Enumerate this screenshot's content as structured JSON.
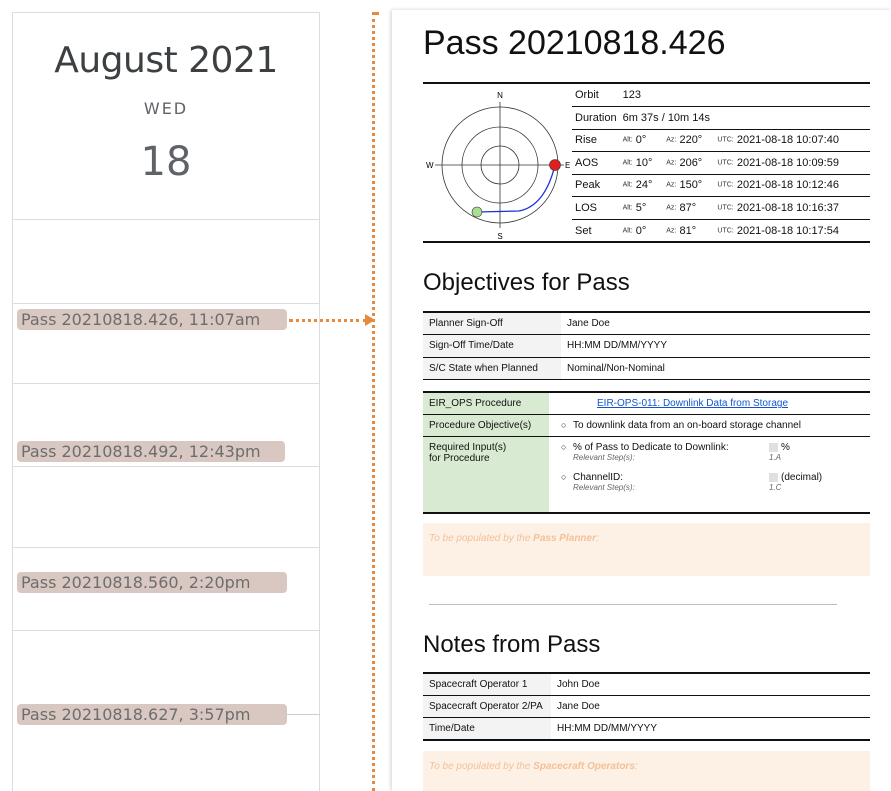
{
  "calendar": {
    "month": "August 2021",
    "weekday": "WED",
    "day": "18",
    "events": [
      {
        "label": "Pass 20210818.426, 11:07am"
      },
      {
        "label": "Pass 20210818.492, 12:43pm"
      },
      {
        "label": "Pass 20210818.560, 2:20pm"
      },
      {
        "label": "Pass 20210818.627, 3:57pm"
      }
    ]
  },
  "colors": {
    "connector": "#e58a3c",
    "event_chip": "#d9c8c2",
    "procedure_key_bg": "#d9ead3",
    "note_bg": "#fdf0e5",
    "note_text": "#f3c197",
    "link": "#1155cc",
    "polar_rise_marker": "#e02020",
    "polar_set_marker": "#a7e08f",
    "polar_track": "#1c2fd8"
  },
  "document": {
    "title": "Pass 20210818.426",
    "polar_plot": {
      "n": "N",
      "s": "S",
      "e": "E",
      "w": "W"
    },
    "orbit": {
      "label": "Orbit",
      "value": "123"
    },
    "duration": {
      "label": "Duration",
      "value": "6m 37s / 10m 14s"
    },
    "alt_label": "Alt:",
    "az_label": "Az:",
    "utc_label": "UTC:",
    "events": [
      {
        "name": "Rise",
        "alt": "0°",
        "az": "220°",
        "utc": "2021-08-18 10:07:40"
      },
      {
        "name": "AOS",
        "alt": "10°",
        "az": "206°",
        "utc": "2021-08-18 10:09:59"
      },
      {
        "name": "Peak",
        "alt": "24°",
        "az": "150°",
        "utc": "2021-08-18 10:12:46"
      },
      {
        "name": "LOS",
        "alt": "5°",
        "az": "87°",
        "utc": "2021-08-18 10:16:37"
      },
      {
        "name": "Set",
        "alt": "0°",
        "az": "81°",
        "utc": "2021-08-18 10:17:54"
      }
    ],
    "objectives": {
      "heading": "Objectives for Pass",
      "rows": [
        {
          "key": "Planner Sign-Off",
          "value": "Jane Doe"
        },
        {
          "key": "Sign-Off Time/Date",
          "value": "HH:MM DD/MM/YYYY"
        },
        {
          "key": "S/C State when Planned",
          "value": "Nominal/Non-Nominal"
        }
      ],
      "procedure": {
        "key": "EIR_OPS Procedure",
        "link": "EIR-OPS-011: Downlink Data from Storage",
        "objective_key": "Procedure Objective(s)",
        "objective_bullet": "○",
        "objective": "To downlink data from an on-board storage channel",
        "inputs_key_line1": "Required Input(s)",
        "inputs_key_line2": "for Procedure",
        "inputs": [
          {
            "bullet": "○",
            "label": "% of Pass to Dedicate to Downlink:",
            "relevant": "Relevant Step(s):",
            "unit": "%",
            "step": "1.A"
          },
          {
            "bullet": "○",
            "label": "ChannelID:",
            "relevant": "Relevant Step(s):",
            "unit": "(decimal)",
            "step": "1.C"
          }
        ]
      },
      "note_prefix": "To be populated by the ",
      "note_emph": "Pass Planner",
      "note_suffix": ":"
    },
    "notes": {
      "heading": "Notes from Pass",
      "rows": [
        {
          "key": "Spacecraft Operator 1",
          "value": "John Doe"
        },
        {
          "key": "Spacecraft Operator 2/PA",
          "value": "Jane Doe"
        },
        {
          "key": "Time/Date",
          "value": "HH:MM DD/MM/YYYY"
        }
      ],
      "note_prefix": "To be populated by the ",
      "note_emph": "Spacecraft Operators",
      "note_suffix": ":"
    }
  }
}
